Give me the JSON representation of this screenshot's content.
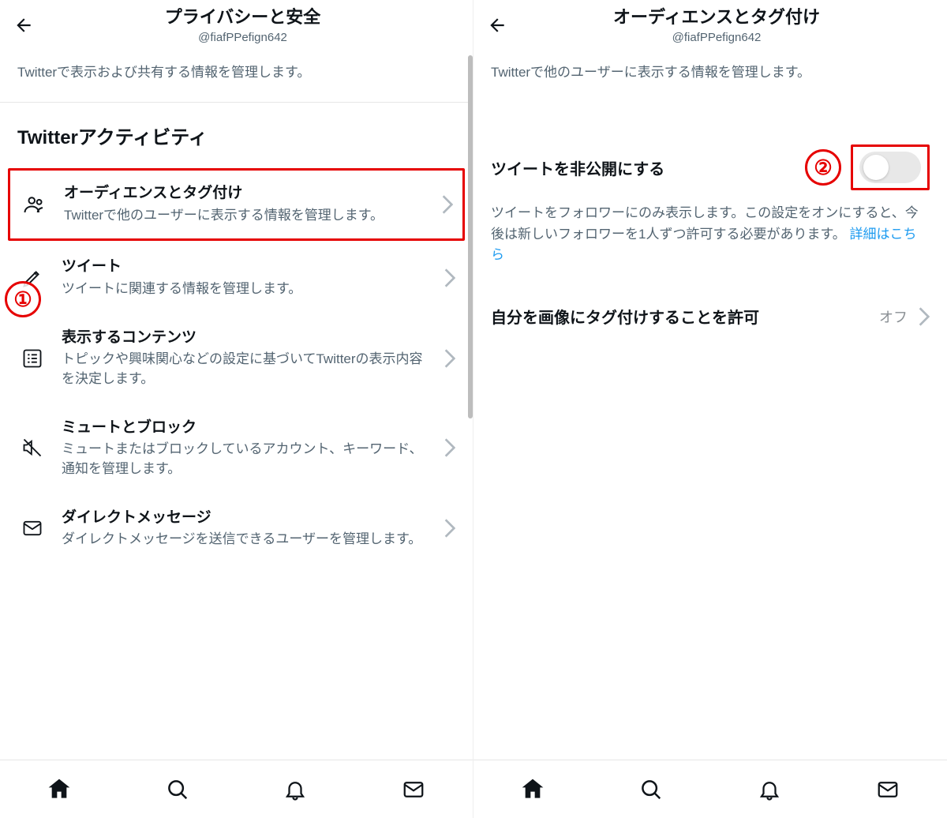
{
  "left": {
    "header": {
      "title": "プライバシーと安全",
      "handle": "@fiafPPefign642"
    },
    "description": "Twitterで表示および共有する情報を管理します。",
    "section_title": "Twitterアクティビティ",
    "items": [
      {
        "title": "オーディエンスとタグ付け",
        "desc": "Twitterで他のユーザーに表示する情報を管理します。"
      },
      {
        "title": "ツイート",
        "desc": "ツイートに関連する情報を管理します。"
      },
      {
        "title": "表示するコンテンツ",
        "desc": "トピックや興味関心などの設定に基づいてTwitterの表示内容を決定します。"
      },
      {
        "title": "ミュートとブロック",
        "desc": "ミュートまたはブロックしているアカウント、キーワード、通知を管理します。"
      },
      {
        "title": "ダイレクトメッセージ",
        "desc": "ダイレクトメッセージを送信できるユーザーを管理します。"
      }
    ],
    "annotation": "①"
  },
  "right": {
    "header": {
      "title": "オーディエンスとタグ付け",
      "handle": "@fiafPPefign642"
    },
    "description": "Twitterで他のユーザーに表示する情報を管理します。",
    "protect": {
      "label": "ツイートを非公開にする",
      "desc": "ツイートをフォロワーにのみ表示します。この設定をオンにすると、今後は新しいフォロワーを1人ずつ許可する必要があります。",
      "link": "詳細はこちら"
    },
    "tagging": {
      "label": "自分を画像にタグ付けすることを許可",
      "value": "オフ"
    },
    "annotation": "②"
  }
}
